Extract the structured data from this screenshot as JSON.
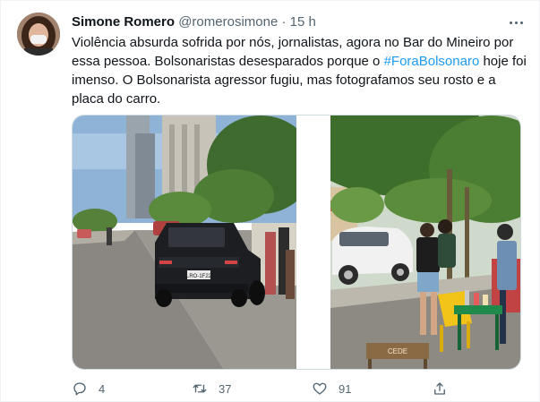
{
  "tweet": {
    "author": {
      "name": "Simone Romero",
      "handle": "@romerosimone",
      "separator": "·",
      "time": "15 h"
    },
    "text": {
      "part1": "Violência absurda sofrida por nós, jornalistas, agora no Bar do Mineiro por essa pessoa. Bolsonaristas desesparados porque o ",
      "hashtag": "#ForaBolsonaro",
      "part2": "  hoje foi imenso. O Bolsonarista agressor fugiu, mas fotografamos seu rosto e a placa do carro."
    },
    "media": {
      "left": {
        "plate": "LRO-1F22"
      },
      "right": {
        "sign": "CEDE"
      }
    },
    "actions": {
      "reply": {
        "icon": "reply-icon",
        "count": "4"
      },
      "retweet": {
        "icon": "retweet-icon",
        "count": "37"
      },
      "like": {
        "icon": "heart-icon",
        "count": "91"
      },
      "share": {
        "icon": "share-icon"
      }
    },
    "colors": {
      "link": "#1d9bf0",
      "muted": "#536471",
      "text": "#0f1419"
    }
  }
}
